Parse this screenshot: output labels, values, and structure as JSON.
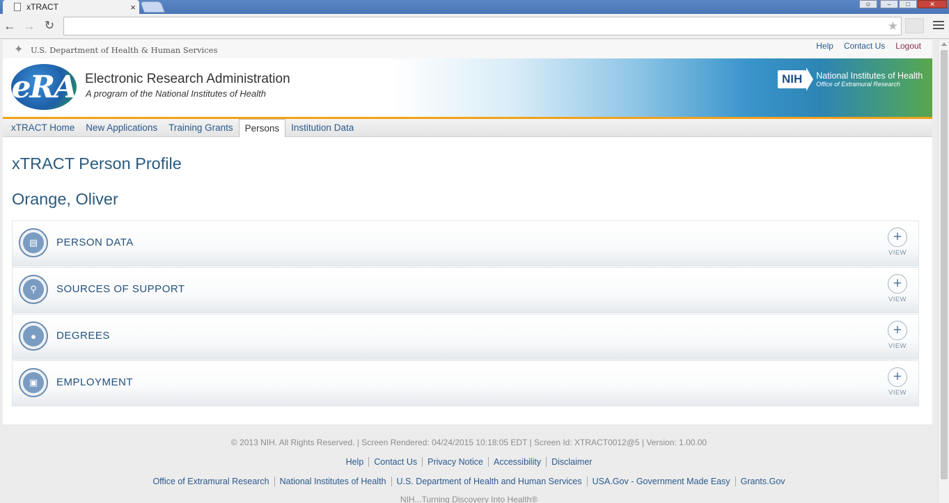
{
  "browser": {
    "tab_title": "xTRACT",
    "tab_close": "×",
    "address": "",
    "window_controls": {
      "user": "☺",
      "minimize": "–",
      "maximize": "□",
      "close": "✕"
    },
    "icons": {
      "back": "←",
      "forward": "→",
      "reload": "↻",
      "star": "★"
    }
  },
  "header": {
    "hhs_text": "U.S. Department of Health & Human Services",
    "links": [
      {
        "label": "Help"
      },
      {
        "label": "Contact Us"
      },
      {
        "label": "Logout"
      }
    ]
  },
  "banner": {
    "logo_text": "eRA",
    "title": "Electronic Research Administration",
    "subtitle": "A program of the National Institutes of Health",
    "nih_mark": "NIH",
    "nih_name": "National Institutes of Health",
    "nih_office": "Office of Extramural Research"
  },
  "nav": {
    "tabs": [
      {
        "label": "xTRACT Home",
        "active": false
      },
      {
        "label": "New Applications",
        "active": false
      },
      {
        "label": "Training Grants",
        "active": false
      },
      {
        "label": "Persons",
        "active": true
      },
      {
        "label": "Institution Data",
        "active": false
      }
    ]
  },
  "main": {
    "page_title": "xTRACT Person Profile",
    "person_name": "Orange, Oliver",
    "view_symbol": "+",
    "sections": [
      {
        "label": "PERSON DATA",
        "action": "VIEW",
        "icon": "id-card-icon"
      },
      {
        "label": "SOURCES OF SUPPORT",
        "action": "VIEW",
        "icon": "search-document-icon"
      },
      {
        "label": "DEGREES",
        "action": "VIEW",
        "icon": "graduate-icon"
      },
      {
        "label": "EMPLOYMENT",
        "action": "VIEW",
        "icon": "briefcase-icon"
      }
    ]
  },
  "footer": {
    "copyright": "© 2013 NIH. All Rights Reserved. | Screen Rendered: 04/24/2015 10:18:05 EDT | Screen Id: XTRACT0012@5 | Version: 1.00.00",
    "links": [
      "Help",
      "Contact Us",
      "Privacy Notice",
      "Accessibility",
      "Disclaimer"
    ],
    "links2": [
      "Office of Extramural Research",
      "National Institutes of Health",
      "U.S. Department of Health and Human Services",
      "USA.Gov - Government Made Easy",
      "Grants.Gov"
    ],
    "tagline": "NIH...Turning Discovery Into Health®"
  },
  "colors": {
    "accent_orange": "#f0a21d",
    "link_blue": "#2a5a8e",
    "logout": "#8a2d52",
    "heading": "#2a5a7e"
  }
}
